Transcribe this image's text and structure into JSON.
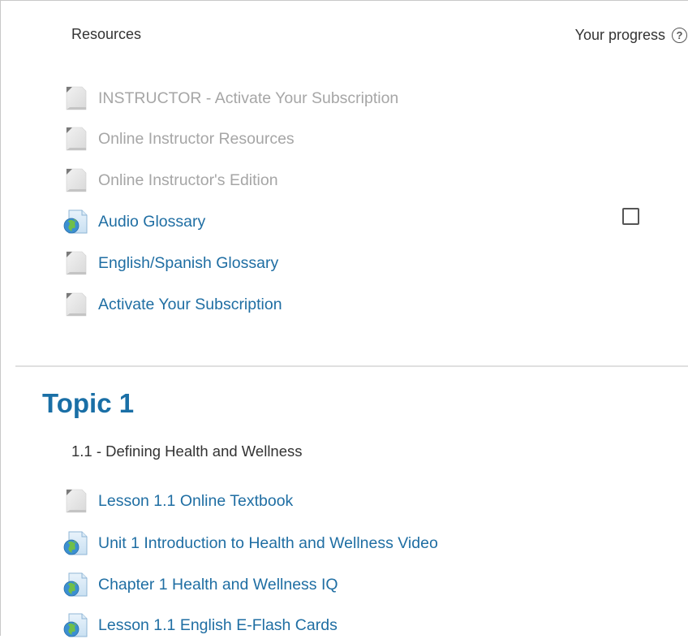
{
  "resources": {
    "title": "Resources",
    "progress_label": "Your progress",
    "help_glyph": "?",
    "items": [
      {
        "label": "INSTRUCTOR - Activate Your Subscription",
        "icon": "page-icon",
        "state": "dimmed"
      },
      {
        "label": "Online Instructor Resources",
        "icon": "page-icon",
        "state": "dimmed"
      },
      {
        "label": "Online Instructor's Edition",
        "icon": "page-icon",
        "state": "dimmed"
      },
      {
        "label": "Audio Glossary",
        "icon": "url-globe-icon",
        "state": "link",
        "completion": false
      },
      {
        "label": "English/Spanish Glossary",
        "icon": "page-icon",
        "state": "link"
      },
      {
        "label": "Activate Your Subscription",
        "icon": "page-icon",
        "state": "link"
      }
    ]
  },
  "topic1": {
    "title": "Topic 1",
    "subheading": "1.1 - Defining Health and Wellness",
    "items": [
      {
        "label": "Lesson 1.1 Online Textbook",
        "icon": "page-icon",
        "state": "link"
      },
      {
        "label": "Unit 1 Introduction to Health and Wellness Video",
        "icon": "url-globe-icon",
        "state": "link"
      },
      {
        "label": "Chapter 1 Health and Wellness IQ",
        "icon": "url-globe-icon",
        "state": "link"
      },
      {
        "label": "Lesson 1.1 English E-Flash Cards",
        "icon": "url-globe-icon",
        "state": "link"
      }
    ]
  },
  "colors": {
    "link": "#1f6ea3",
    "dimmed": "#a6a6a6",
    "topic_heading": "#1a6fa6",
    "text": "#333333"
  }
}
